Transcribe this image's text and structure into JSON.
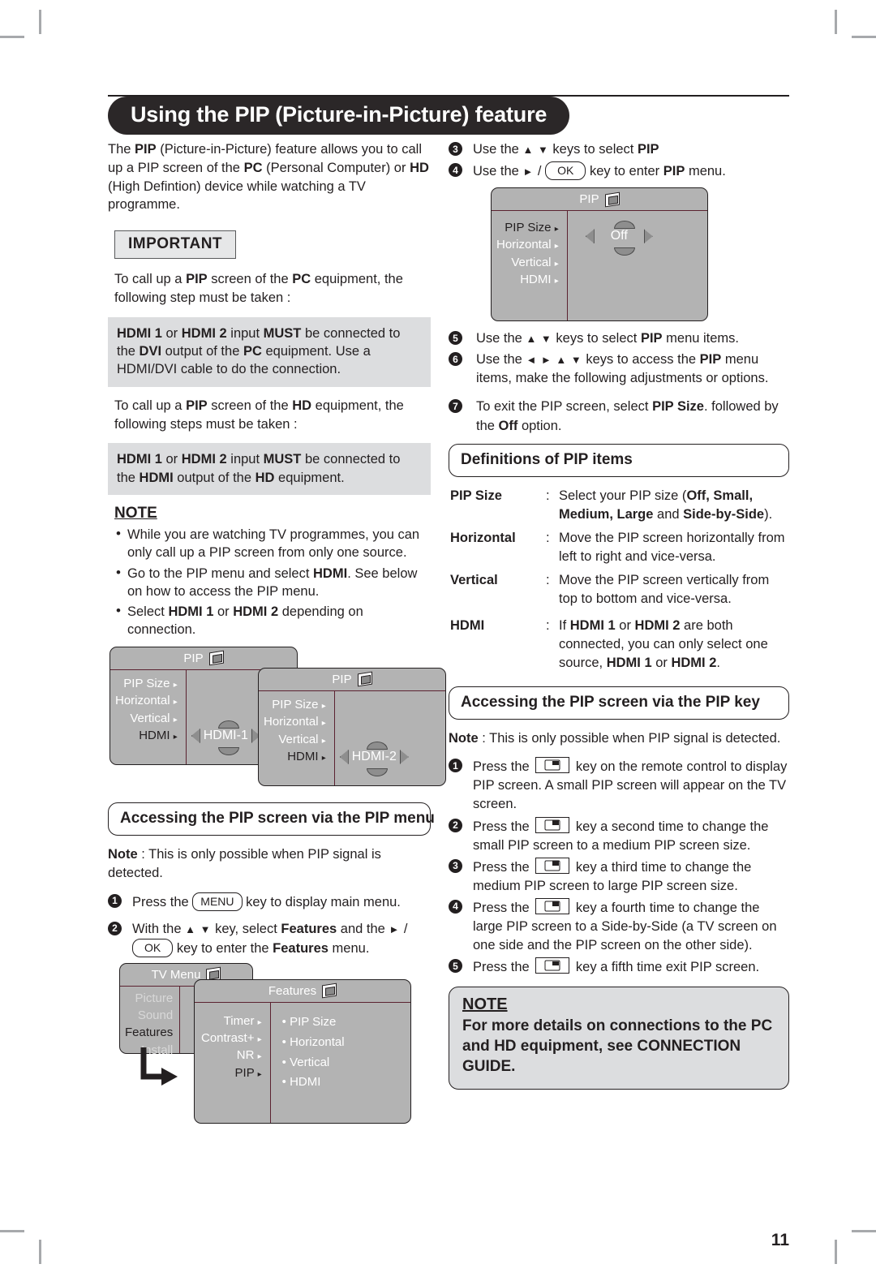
{
  "header": {
    "title": "Using the PIP (Picture-in-Picture) feature"
  },
  "left": {
    "intro_html": "The <b>PIP</b> (Picture-in-Picture) feature allows you to call up a PIP screen of the <b>PC</b> (Personal Computer)  or <b>HD</b> (High Defintion) device while watching a TV programme.",
    "important_label": "IMPORTANT",
    "pc_lead_html": "To call up a <b>PIP</b> screen of the <b>PC</b> equipment, the following step must be taken :",
    "pc_box_html": "<b>HDMI 1</b> or <b>HDMI 2</b> input <b>MUST</b> be connected to the <b>DVI</b> output of the <b>PC</b> equipment. Use a HDMI/DVI cable to do the connection.",
    "hd_lead_html": "To call up a <b>PIP</b> screen of the <b>HD</b> equipment, the following steps must be taken :",
    "hd_box_html": "<b>HDMI 1</b> or <b>HDMI 2</b> input <b>MUST</b> be connected to the <b>HDMI</b> output of the <b>HD</b> equipment.",
    "note_label": "NOTE",
    "notes_html": [
      "While you are watching TV programmes, you can only call up a PIP screen from only one source.",
      "Go to the PIP menu and select <b>HDMI</b>. See below on how to access the PIP menu.",
      "Select <b>HDMI 1</b> or <b>HDMI 2</b> depending on connection."
    ],
    "osd_hdmi1": {
      "title": "PIP",
      "items": [
        "PIP Size",
        "Horizontal",
        "Vertical",
        "HDMI"
      ],
      "selected": "HDMI",
      "value": "HDMI-1"
    },
    "osd_hdmi2": {
      "title": "PIP",
      "items": [
        "PIP Size",
        "Horizontal",
        "Vertical",
        "HDMI"
      ],
      "selected": "HDMI",
      "value": "HDMI-2"
    },
    "banner_menu": "Accessing the PIP screen via the PIP menu",
    "note_menu_html": "<b>Note</b> : This is only possible when PIP signal is detected.",
    "step1_pre": "Press the",
    "step1_key": "MENU",
    "step1_post": "key to display main menu.",
    "step2_pre": "With the",
    "step2_mid": "key, select",
    "step2_bold1": "Features",
    "step2_and": "and the",
    "step2_key": "OK",
    "step2_post": "key to enter the",
    "step2_bold2": "Features",
    "step2_end": "menu.",
    "tv_menu": {
      "title": "TV Menu",
      "items": [
        "Picture",
        "Sound",
        "Features",
        "Install"
      ],
      "selected": "Features"
    },
    "features_menu": {
      "title": "Features",
      "items": [
        "Timer",
        "Contrast+",
        "NR",
        "PIP"
      ],
      "selected": "PIP",
      "sub_items": [
        "PIP Size",
        "Horizontal",
        "Vertical",
        "HDMI"
      ]
    }
  },
  "right": {
    "step3_pre": "Use the",
    "step3_post_html": "keys to select <b>PIP</b>",
    "step4_pre": "Use the",
    "step4_key": "OK",
    "step4_post_html": "key to enter <b>PIP</b> menu.",
    "osd_pip": {
      "title": "PIP",
      "items": [
        "PIP Size",
        "Horizontal",
        "Vertical",
        "HDMI"
      ],
      "selected": "PIP Size",
      "value": "Off"
    },
    "step5_html": "Use the <span class='arw'>▲ ▼</span> keys to select <b>PIP</b> menu items.",
    "step6_html": "Use the <span class='arw'>◄ ► ▲ ▼</span> keys to access the <b>PIP</b> menu items, make the following adjustments or options.",
    "step7_html": "To exit the PIP screen, select <b>PIP Size</b>. followed by the <b>Off</b> option.",
    "banner_defs": "Definitions of PIP items",
    "definitions": [
      {
        "term": "PIP Size",
        "desc_html": "Select your PIP size (<b>Off, Small, Medium, Large</b> and <b>Side-by-Side</b>)."
      },
      {
        "term": "Horizontal",
        "desc_html": "Move the PIP screen horizontally from left to right and vice-versa."
      },
      {
        "term": "Vertical",
        "desc_html": "Move the PIP screen vertically from top to bottom and vice-versa."
      },
      {
        "term": "HDMI",
        "desc_html": "If <b>HDMI 1</b> or <b>HDMI 2</b> are both connected, you can only select one source, <b>HDMI 1</b> or <b>HDMI 2</b>."
      }
    ],
    "banner_key": "Accessing the PIP screen via the PIP key",
    "note_key_html": "<b>Note</b> : This is only possible when PIP signal is detected.",
    "key_steps": [
      {
        "pre": "Press the",
        "post": "key on the remote control to display PIP screen. A small PIP screen will appear on the TV screen."
      },
      {
        "pre": "Press the",
        "post": "key a second time to change the small PIP screen to a medium PIP screen size."
      },
      {
        "pre": "Press the",
        "post": "key a third time to change the medium PIP screen to large PIP screen size."
      },
      {
        "pre": "Press the",
        "post": "key a fourth time to change the large PIP screen to a Side-by-Side (a TV screen on one side and the PIP screen on the other side)."
      },
      {
        "pre": "Press the",
        "post": "key a fifth time exit PIP screen."
      }
    ],
    "note_box": {
      "head": "NOTE",
      "body_html": "For more details on connections to the <b>PC</b> and <b>HD</b> equipment, see <b>CONNECTION GUIDE.</b>"
    }
  },
  "page_number": "11",
  "colors": {
    "header_pill": "#2b2728",
    "osd_grey": "#b3b3b3",
    "box_grey": "#dcdddf",
    "rule_maroon": "#5b2230"
  }
}
